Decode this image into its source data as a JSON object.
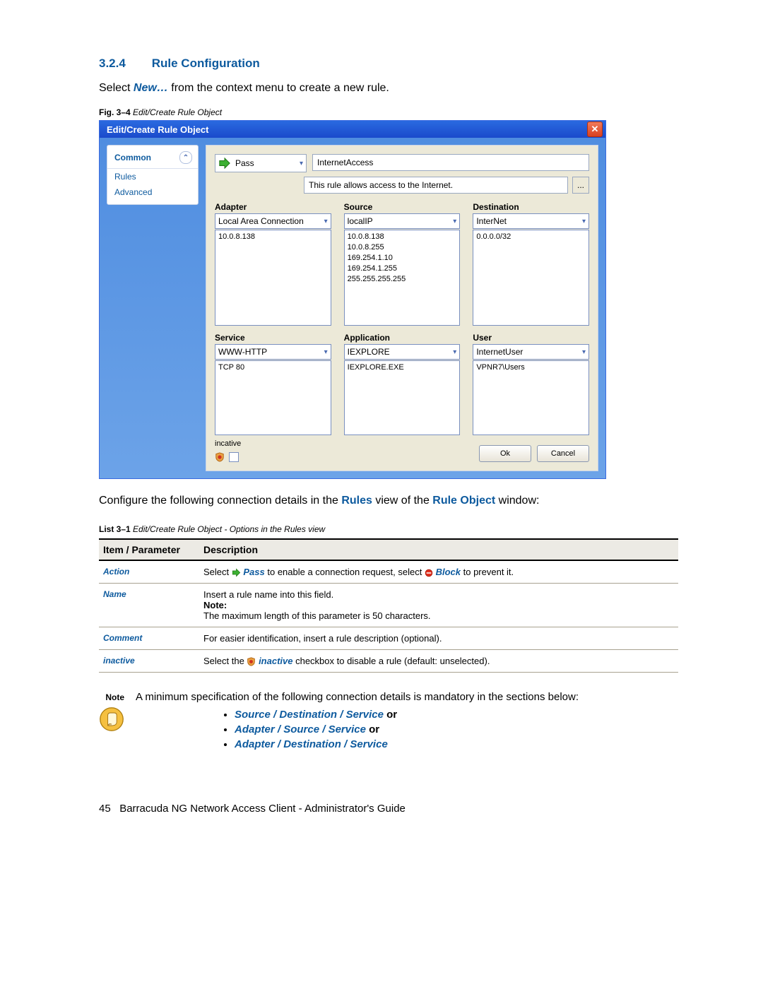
{
  "section": {
    "number": "3.2.4",
    "title": "Rule Configuration"
  },
  "intro": {
    "prefix": "Select ",
    "new_ref": "New…",
    "suffix": " from the context menu to create a new rule."
  },
  "fig_caption": {
    "label": "Fig. 3–4",
    "title": "Edit/Create Rule Object"
  },
  "dialog": {
    "title": "Edit/Create Rule Object",
    "sidebar": {
      "header": "Common",
      "items": [
        "Rules",
        "Advanced"
      ]
    },
    "action_label": "Pass",
    "rule_name": "InternetAccess",
    "comment": "This rule allows access to the Internet.",
    "dots": "...",
    "cols": {
      "adapter": {
        "label": "Adapter",
        "selected": "Local Area Connection",
        "items": [
          "10.0.8.138"
        ]
      },
      "source": {
        "label": "Source",
        "selected": "localIP",
        "items": [
          "10.0.8.138",
          "10.0.8.255",
          "169.254.1.10",
          "169.254.1.255",
          "255.255.255.255"
        ]
      },
      "destination": {
        "label": "Destination",
        "selected": "InterNet",
        "items": [
          "0.0.0.0/32"
        ]
      },
      "service": {
        "label": "Service",
        "selected": "WWW-HTTP",
        "items": [
          "TCP  80"
        ]
      },
      "application": {
        "label": "Application",
        "selected": "IEXPLORE",
        "items": [
          "IEXPLORE.EXE"
        ]
      },
      "user": {
        "label": "User",
        "selected": "InternetUser",
        "items": [
          "VPNR7\\Users"
        ]
      }
    },
    "inactive_label": "incative",
    "ok": "Ok",
    "cancel": "Cancel"
  },
  "after_fig": {
    "prefix": "Configure the following connection details in the ",
    "rules_ref": "Rules",
    "mid": " view of the ",
    "ruleobj_ref": "Rule Object",
    "suffix": " window:"
  },
  "list_caption": {
    "label": "List 3–1",
    "title": "Edit/Create Rule Object - Options in the Rules view"
  },
  "table": {
    "h1": "Item / Parameter",
    "h2": "Description",
    "rows": [
      {
        "name": "Action",
        "desc_pre": "Select ",
        "pass": "Pass",
        "desc_mid": " to enable a connection request, select ",
        "block": "Block",
        "desc_post": " to prevent it."
      },
      {
        "name": "Name",
        "line1": "Insert a rule name into this field.",
        "note_label": "Note:",
        "line2": "The maximum length of this parameter is 50 characters."
      },
      {
        "name": "Comment",
        "line1": "For easier identification, insert a rule description (optional)."
      },
      {
        "name": "inactive",
        "desc_pre": "Select the ",
        "inactive_ref": "inactive",
        "desc_post": " checkbox to disable a rule (default: unselected)."
      }
    ]
  },
  "note": {
    "label": "Note",
    "text": "A minimum specification of the following connection details is mandatory in the sections below:",
    "bullets": [
      {
        "a": "Source",
        "b": "Destination",
        "c": "Service",
        "or": "or"
      },
      {
        "a": "Adapter",
        "b": "Source",
        "c": "Service",
        "or": "or"
      },
      {
        "a": "Adapter",
        "b": "Destination",
        "c": "Service",
        "or": ""
      }
    ],
    "sep": " / "
  },
  "footer": {
    "page": "45",
    "title": "Barracuda NG Network Access Client - Administrator's Guide"
  }
}
